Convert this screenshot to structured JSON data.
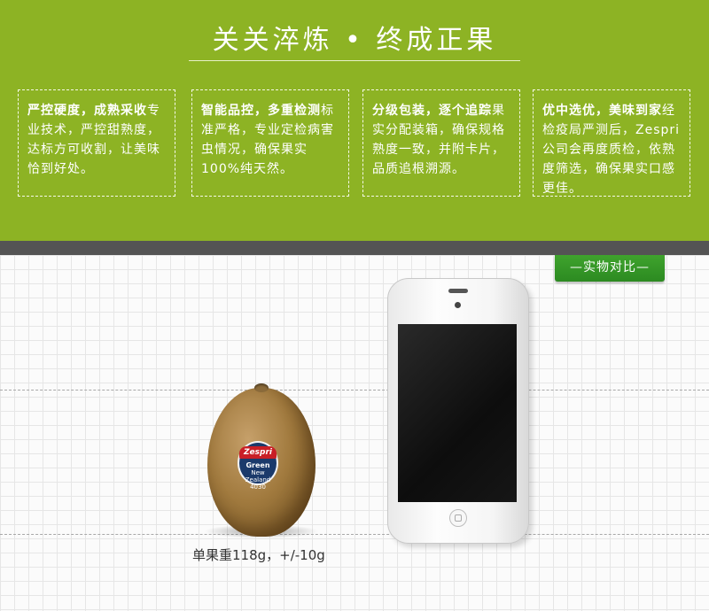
{
  "banner": {
    "title": "关关淬炼 • 终成正果",
    "background_color": "#8db324"
  },
  "cards": [
    {
      "heading": "严控硬度，成熟采收",
      "body": "专业技术，严控甜熟度，达标方可收割，让美味恰到好处。"
    },
    {
      "heading": "智能品控，多重检测",
      "body": "标准严格，专业定检病害虫情况，确保果实100%纯天然。"
    },
    {
      "heading": "分级包装，逐个追踪",
      "body": "果实分配装箱，确保规格熟度一致，并附卡片，品质追根溯源。"
    },
    {
      "heading": "优中选优，美味到家",
      "body": "经检疫局严测后，Zespri公司会再度质检，依熟度筛选，确保果实口感更佳。"
    }
  ],
  "comparison": {
    "tag_label": "—实物对比—",
    "tag_color": "#2f8f24",
    "caption": "单果重118g，+/-10g",
    "kiwi_sticker": {
      "brand": "Zespri",
      "variety": "Green",
      "origin": "New Zealand",
      "code": "4030"
    }
  }
}
